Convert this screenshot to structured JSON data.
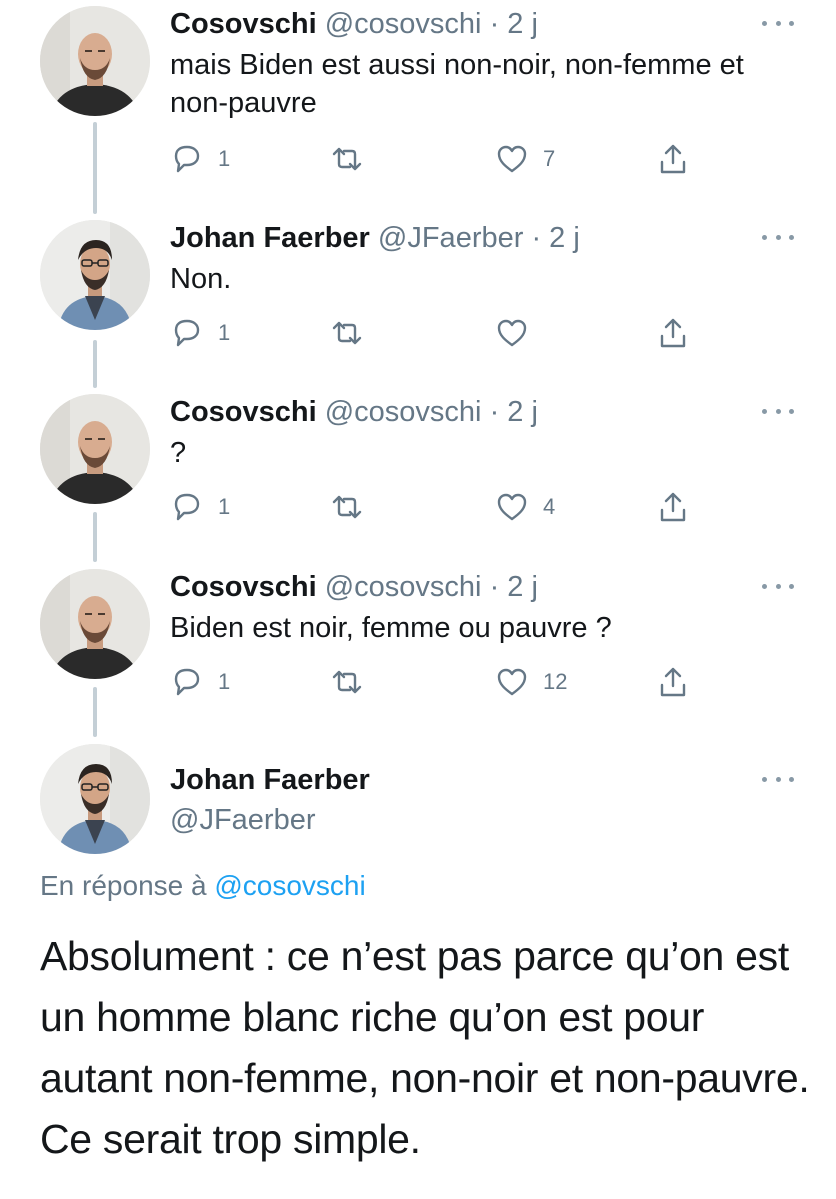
{
  "tweets": [
    {
      "name": "Cosovschi",
      "handle": "@cosovschi",
      "time": "· 2 j",
      "text": "mais Biden est aussi non-noir, non-femme et non-pauvre",
      "replies": "1",
      "retweets": "",
      "likes": "7"
    },
    {
      "name": "Johan Faerber",
      "handle": "@JFaerber",
      "time": "· 2 j",
      "text": "Non.",
      "replies": "1",
      "retweets": "",
      "likes": ""
    },
    {
      "name": "Cosovschi",
      "handle": "@cosovschi",
      "time": "· 2 j",
      "text": "?",
      "replies": "1",
      "retweets": "",
      "likes": "4"
    },
    {
      "name": "Cosovschi",
      "handle": "@cosovschi",
      "time": "· 2 j",
      "text": "Biden est noir, femme ou pauvre ?",
      "replies": "1",
      "retweets": "",
      "likes": "12"
    }
  ],
  "main_tweet": {
    "name": "Johan Faerber",
    "handle": "@JFaerber",
    "reply_prefix": "En réponse à",
    "reply_mention": "@cosovschi",
    "text": "Absolument : ce n’est pas parce qu’on est un homme blanc riche qu’on est pour autant non-femme, non-noir et non-pauvre. Ce serait trop simple."
  },
  "icons": {
    "reply": "reply-icon",
    "retweet": "retweet-icon",
    "like": "heart-icon",
    "share": "share-icon",
    "more": "more-icon"
  },
  "colors": {
    "text": "#14171a",
    "secondary": "#657786",
    "link": "#1da1f2",
    "thread_line": "#c4cfd6"
  }
}
